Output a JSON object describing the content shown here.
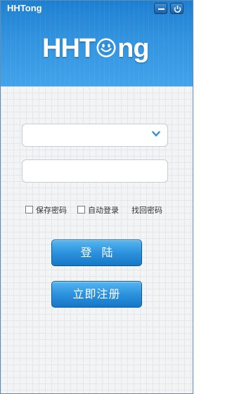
{
  "app": {
    "title": "HHTong",
    "logo_left": "HHT",
    "logo_right": "ng"
  },
  "form": {
    "username_value": "",
    "password_value": ""
  },
  "options": {
    "save_password": "保存密码",
    "auto_login": "自动登录",
    "find_password": "找回密码"
  },
  "buttons": {
    "login": "登陆",
    "register": "立即注册"
  },
  "colors": {
    "header_blue": "#2f8fdc",
    "button_blue": "#2d92dd"
  }
}
